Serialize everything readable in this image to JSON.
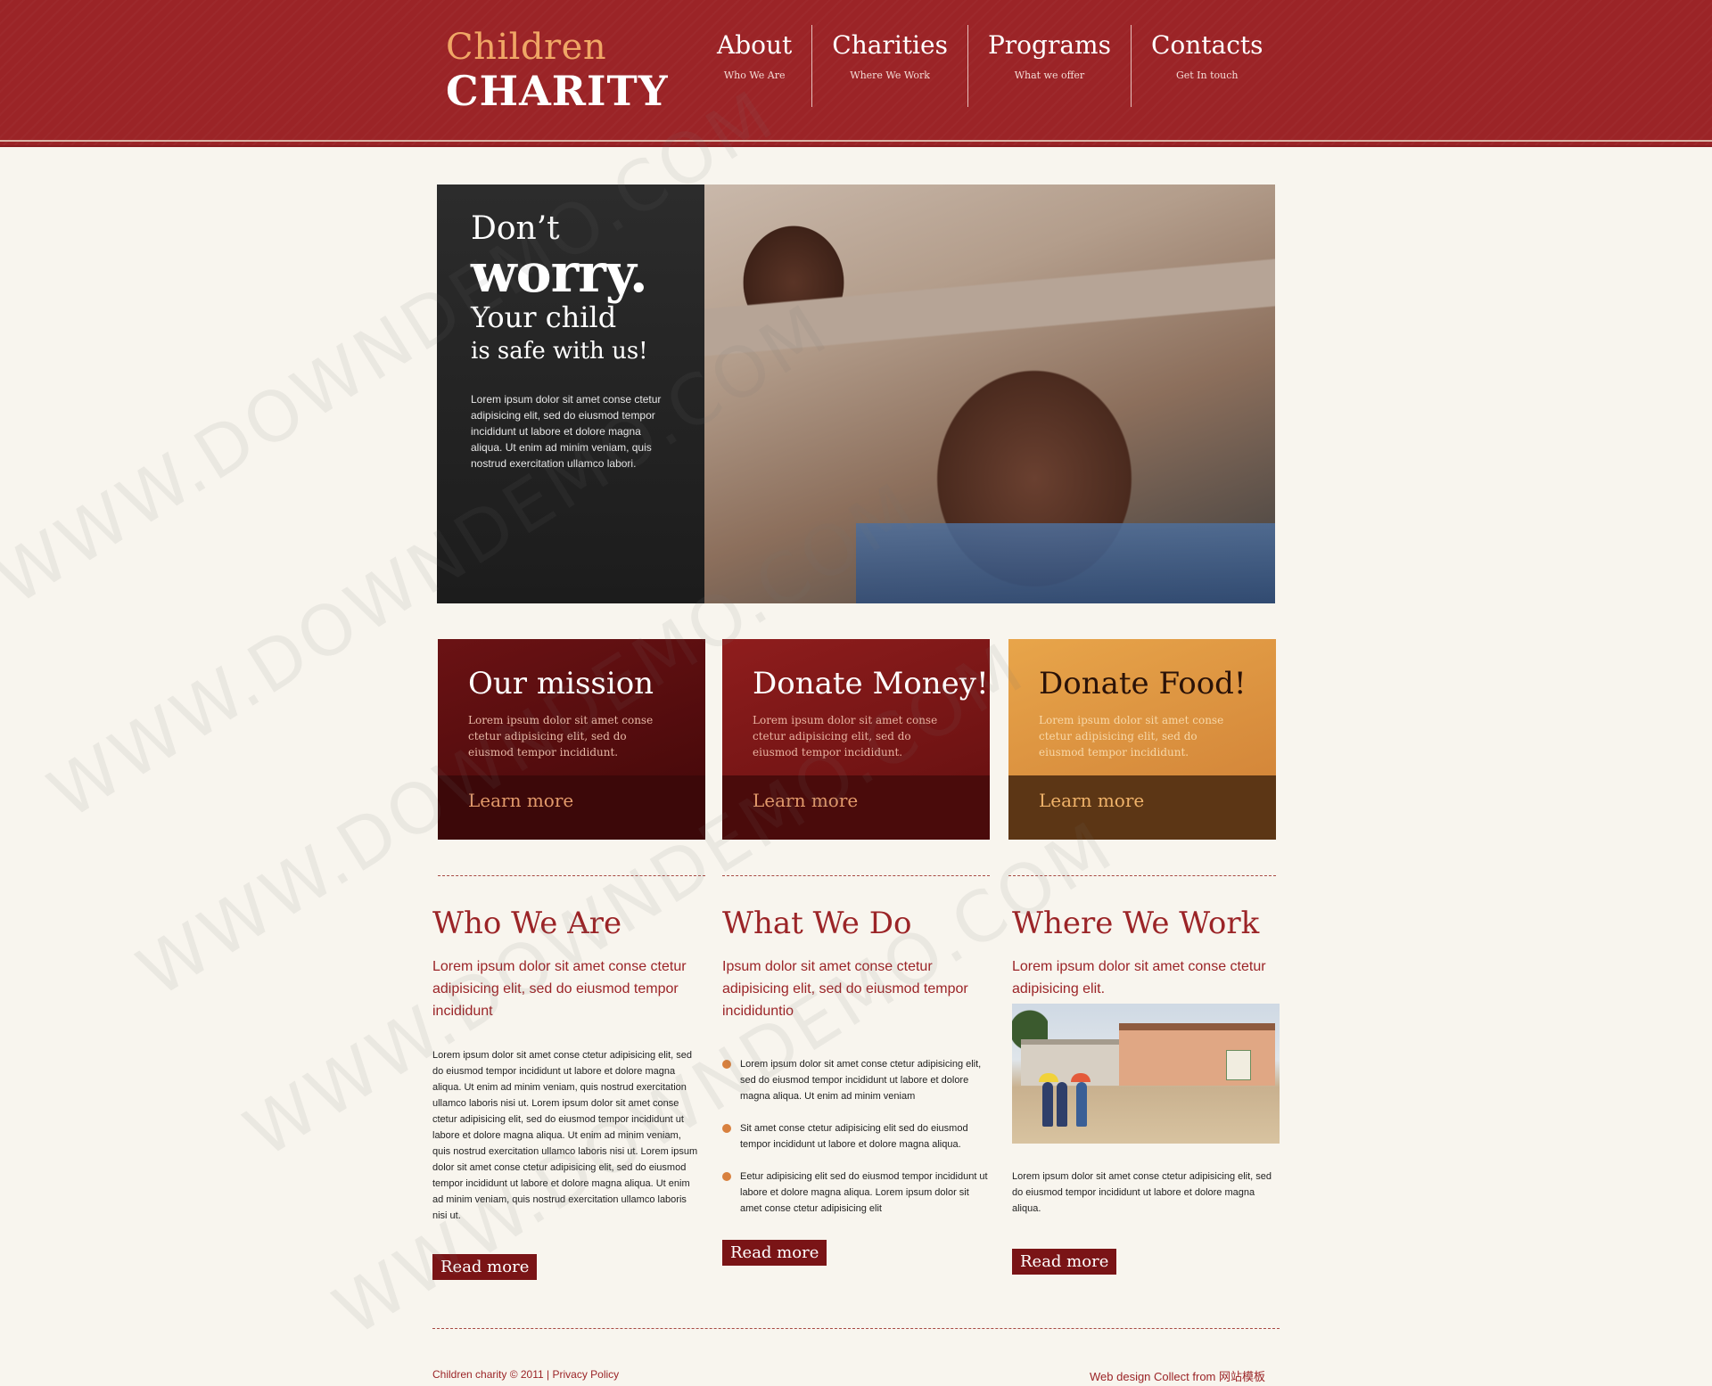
{
  "logo": {
    "line1": "Children",
    "line2": "CHARITY"
  },
  "nav": [
    {
      "title": "About",
      "subtitle": "Who We Are"
    },
    {
      "title": "Charities",
      "subtitle": "Where We Work"
    },
    {
      "title": "Programs",
      "subtitle": "What we offer"
    },
    {
      "title": "Contacts",
      "subtitle": "Get In touch"
    }
  ],
  "hero": {
    "line1": "Don’t",
    "line2": "worry.",
    "line3": "Your child",
    "line4": "is safe with us!",
    "text": "Lorem ipsum dolor sit amet conse ctetur adipisicing elit, sed do eiusmod tempor incididunt ut labore et dolore magna aliqua. Ut enim ad minim veniam, quis nostrud exercitation ullamco labori."
  },
  "boxes": [
    {
      "title": "Our mission",
      "text": "Lorem ipsum dolor sit amet conse ctetur adipisicing elit, sed do eiusmod tempor incididunt.",
      "link": "Learn more"
    },
    {
      "title": "Donate Money!",
      "text": "Lorem ipsum dolor sit amet conse ctetur adipisicing elit, sed do eiusmod tempor incididunt.",
      "link": "Learn more"
    },
    {
      "title": "Donate Food!",
      "text": "Lorem ipsum dolor sit amet conse ctetur adipisicing elit, sed do eiusmod tempor incididunt.",
      "link": "Learn more"
    }
  ],
  "columns": {
    "who": {
      "title": "Who We Are",
      "lead": "Lorem ipsum dolor sit amet conse ctetur adipisicing elit, sed do eiusmod tempor incididunt",
      "body": "Lorem ipsum dolor sit amet conse ctetur adipisicing elit, sed do eiusmod tempor incididunt ut labore et dolore magna aliqua. Ut enim ad minim veniam, quis nostrud exercitation ullamco laboris nisi ut. Lorem ipsum dolor sit amet conse ctetur adipisicing elit, sed do eiusmod tempor incididunt ut labore et dolore magna aliqua. Ut enim ad minim veniam, quis nostrud exercitation ullamco laboris nisi ut. Lorem ipsum dolor sit amet conse ctetur adipisicing elit, sed do eiusmod tempor incididunt ut labore et dolore magna aliqua. Ut enim ad minim veniam, quis nostrud exercitation ullamco laboris nisi ut.",
      "button": "Read more"
    },
    "what": {
      "title": "What We Do",
      "lead": "Ipsum dolor sit amet conse ctetur adipisicing elit, sed do eiusmod tempor incididuntio",
      "bullets": [
        "Lorem ipsum dolor sit amet conse ctetur adipisicing elit, sed do eiusmod tempor incididunt ut labore et dolore magna aliqua. Ut enim ad minim veniam",
        "Sit amet conse ctetur adipisicing elit sed do eiusmod tempor incididunt ut labore et dolore magna aliqua.",
        "Eetur adipisicing elit sed do eiusmod tempor incididunt ut labore et dolore magna aliqua. Lorem ipsum dolor sit amet conse ctetur adipisicing elit"
      ],
      "button": "Read more"
    },
    "where": {
      "title": "Where We Work",
      "lead": "Lorem ipsum dolor sit amet conse ctetur adipisicing elit.",
      "body": "Lorem ipsum dolor sit amet conse ctetur adipisicing elit, sed do eiusmod tempor incididunt ut labore et dolore magna aliqua.",
      "button": "Read more"
    }
  },
  "footer": {
    "copyright": "Children charity © 2011 |",
    "privacy": "Privacy Policy",
    "credit": "Web design Collect from 网站模板"
  },
  "watermark": "WWW.DOWNDEMO.COM",
  "colors": {
    "brand": "#9b2427",
    "accent": "#f0a766",
    "background": "#f8f5ee"
  }
}
